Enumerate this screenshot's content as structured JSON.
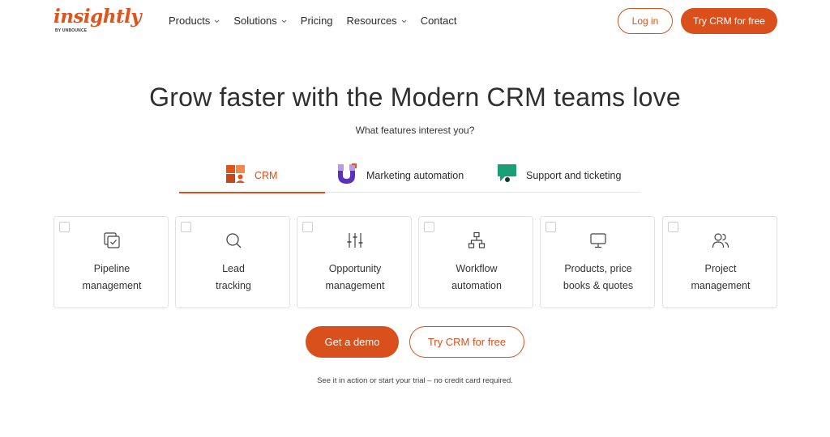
{
  "brand": {
    "name": "insightly",
    "tagline": "BY UNBOUNCE",
    "accent": "#d9501c"
  },
  "nav": {
    "items": [
      {
        "label": "Products",
        "dropdown": true
      },
      {
        "label": "Solutions",
        "dropdown": true
      },
      {
        "label": "Pricing",
        "dropdown": false
      },
      {
        "label": "Resources",
        "dropdown": true
      },
      {
        "label": "Contact",
        "dropdown": false
      }
    ],
    "login_label": "Log in",
    "try_label": "Try CRM for free"
  },
  "hero": {
    "title": "Grow faster with the Modern CRM teams love",
    "subtitle": "What features interest you?"
  },
  "tabs": [
    {
      "label": "CRM",
      "icon": "crm-grid-icon",
      "active": true
    },
    {
      "label": "Marketing automation",
      "icon": "marketing-magnet-icon",
      "active": false
    },
    {
      "label": "Support and ticketing",
      "icon": "support-chat-icon",
      "active": false
    }
  ],
  "features": [
    {
      "label": "Pipeline\nmanagement",
      "icon": "pipeline-icon"
    },
    {
      "label": "Lead\ntracking",
      "icon": "search-icon"
    },
    {
      "label": "Opportunity\nmanagement",
      "icon": "sliders-icon"
    },
    {
      "label": "Workflow\nautomation",
      "icon": "workflow-icon"
    },
    {
      "label": "Products, price\nbooks & quotes",
      "icon": "monitor-icon"
    },
    {
      "label": "Project\nmanagement",
      "icon": "users-icon"
    }
  ],
  "cta": {
    "demo_label": "Get a demo",
    "try_label": "Try CRM for free",
    "note": "See it in action or start your trial – no credit card required."
  }
}
